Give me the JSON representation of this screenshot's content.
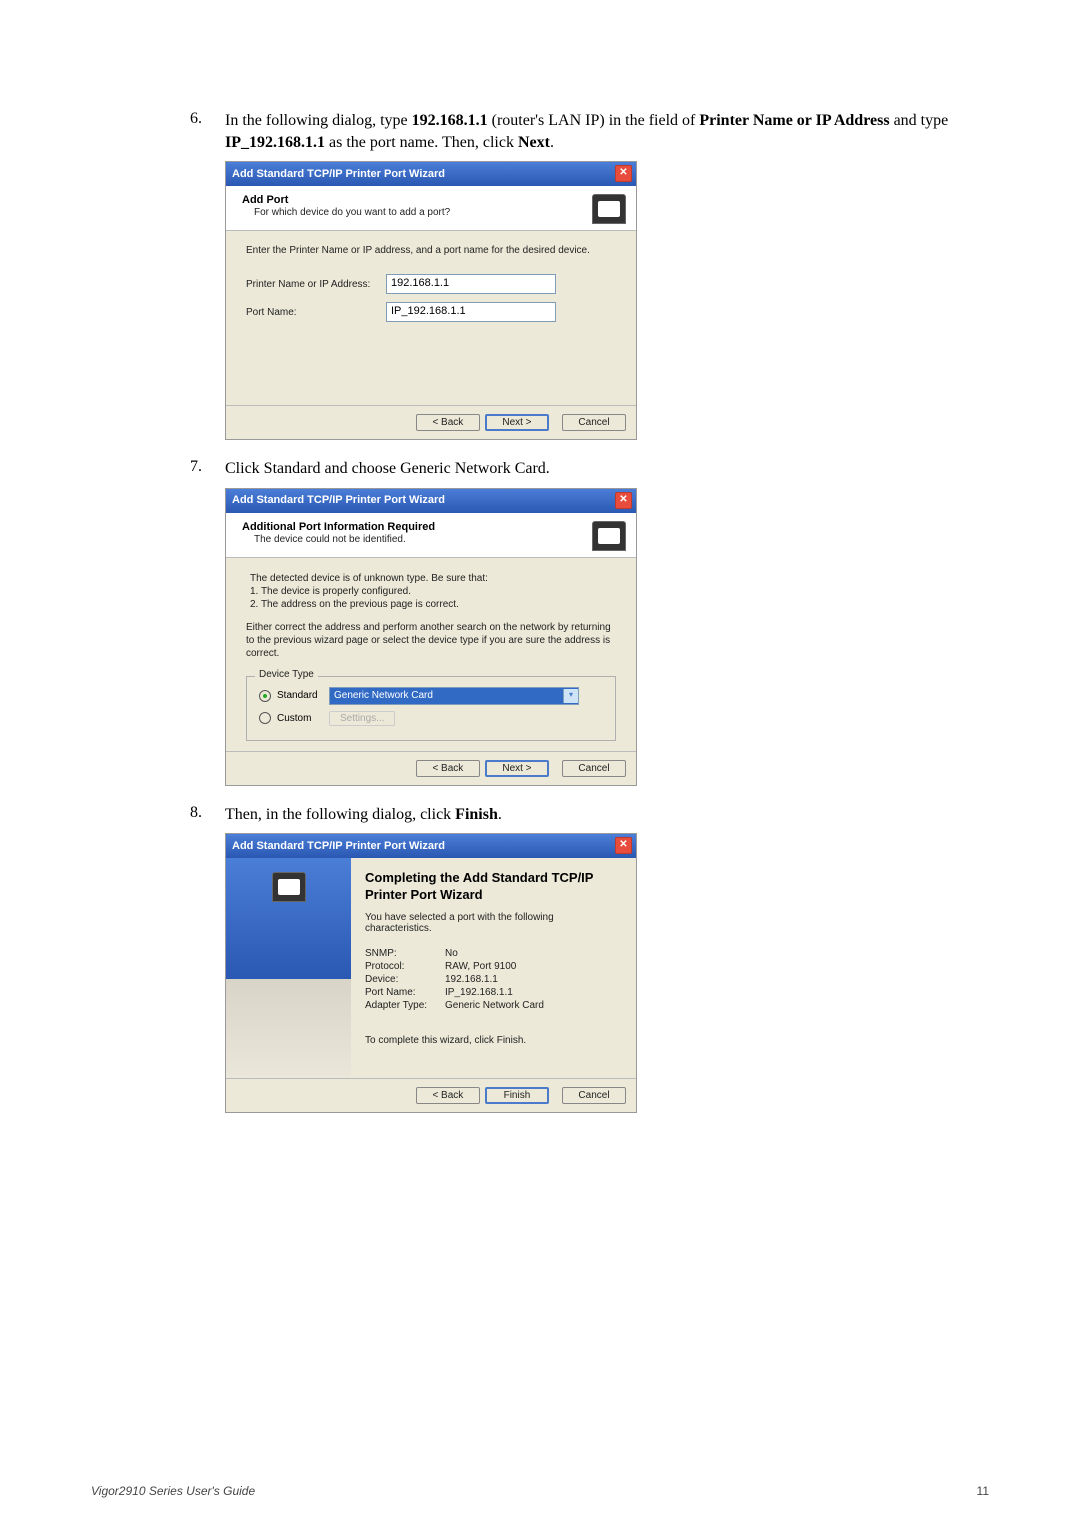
{
  "steps": {
    "s6": {
      "num": "6.",
      "text_a": "In the following dialog, type ",
      "bold_a": "192.168.1.1",
      "text_b": " (router's LAN IP) in the field of ",
      "bold_b": "Printer Name or IP Address",
      "text_c": " and type ",
      "bold_c": "IP_192.168.1.1",
      "text_d": " as the port name. Then, click ",
      "bold_d": "Next",
      "text_e": "."
    },
    "s7": {
      "num": "7.",
      "text": "Click Standard and choose Generic Network Card."
    },
    "s8": {
      "num": "8.",
      "text_a": "Then, in the following dialog, click ",
      "bold_a": "Finish",
      "text_b": "."
    }
  },
  "dialog1": {
    "title": "Add Standard TCP/IP Printer Port Wizard",
    "headerTitle": "Add Port",
    "headerSub": "For which device do you want to add a port?",
    "intro": "Enter the Printer Name or IP address, and a port name for the desired device.",
    "labelAddr": "Printer Name or IP Address:",
    "valAddr": "192.168.1.1",
    "labelPort": "Port Name:",
    "valPort": "IP_192.168.1.1",
    "back": "< Back",
    "next": "Next >",
    "cancel": "Cancel"
  },
  "dialog2": {
    "title": "Add Standard TCP/IP Printer Port Wizard",
    "headerTitle": "Additional Port Information Required",
    "headerSub": "The device could not be identified.",
    "line0": "The detected device is of unknown type.  Be sure that:",
    "line1": "1.  The device is properly configured.",
    "line2": "2.  The address on the previous page is correct.",
    "para": "Either correct the address and perform another search on the network by returning to the previous wizard page or select the device type if you are sure the address is correct.",
    "groupTitle": "Device Type",
    "radioStd": "Standard",
    "combo": "Generic Network Card",
    "radioCustom": "Custom",
    "settings": "Settings...",
    "back": "< Back",
    "next": "Next >",
    "cancel": "Cancel"
  },
  "dialog3": {
    "title": "Add Standard TCP/IP Printer Port Wizard",
    "finishTitle": "Completing the Add Standard TCP/IP Printer Port Wizard",
    "finishSub": "You have selected a port with the following characteristics.",
    "kv": {
      "snmpK": "SNMP:",
      "snmpV": "No",
      "protoK": "Protocol:",
      "protoV": "RAW, Port 9100",
      "devK": "Device:",
      "devV": "192.168.1.1",
      "portK": "Port Name:",
      "portV": "IP_192.168.1.1",
      "adapK": "Adapter Type:",
      "adapV": "Generic Network Card"
    },
    "note": "To complete this wizard, click Finish.",
    "back": "< Back",
    "finish": "Finish",
    "cancel": "Cancel"
  },
  "footer": {
    "left": "Vigor2910 Series User's Guide",
    "right": "11"
  }
}
